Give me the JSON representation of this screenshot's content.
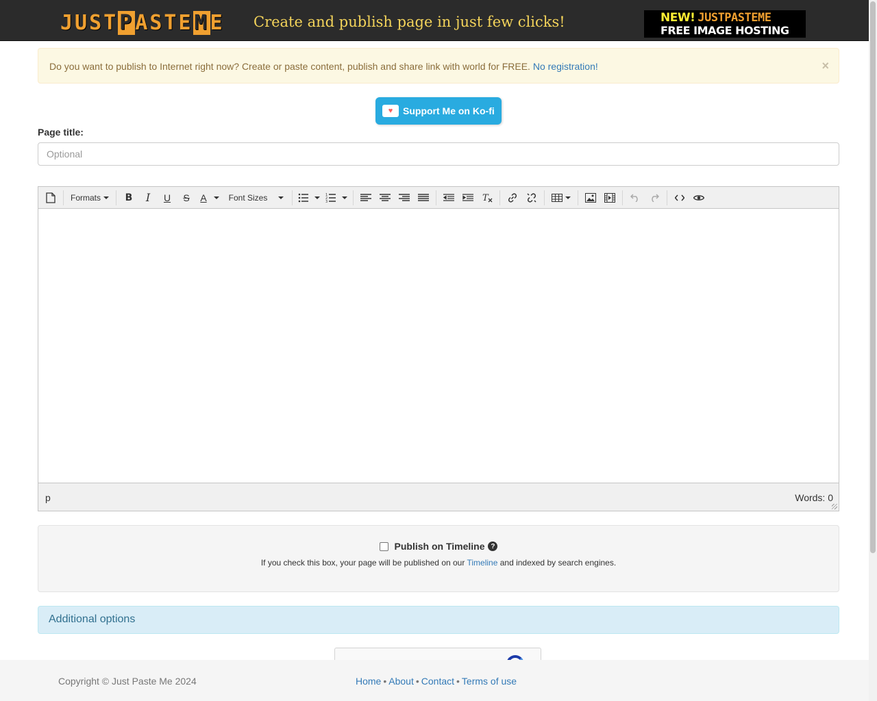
{
  "header": {
    "logo_parts": [
      "JUST",
      "P",
      "ASTE",
      "M",
      "E"
    ],
    "tagline": "Create and publish page in just few clicks!",
    "promo_new": "NEW!",
    "promo_brand": "JUSTPASTEME",
    "promo_line2": "FREE IMAGE HOSTING"
  },
  "alert": {
    "text": "Do you want to publish to Internet right now? Create or paste content, publish and share link with world for FREE.",
    "link": "No registration!",
    "close": "×"
  },
  "kofi": {
    "label": "Support Me on Ko-fi"
  },
  "form": {
    "page_title_label": "Page title:",
    "page_title_placeholder": "Optional",
    "page_title_value": ""
  },
  "editor": {
    "toolbar": {
      "formats": "Formats",
      "font_sizes": "Font Sizes",
      "bold": "B",
      "italic": "I",
      "underline": "U",
      "strike": "S",
      "text_color": "A"
    },
    "status_path": "p",
    "word_count": "Words: 0"
  },
  "publish": {
    "label": "Publish on Timeline",
    "help_icon": "?",
    "hint_before": "If you check this box, your page will be published on our",
    "hint_link": "Timeline",
    "hint_after": "and indexed by search engines."
  },
  "additional_options": "Additional options",
  "footer": {
    "copyright": "Copyright © Just Paste Me 2024",
    "links": [
      "Home",
      "About",
      "Contact",
      "Terms of use"
    ],
    "separator": "•"
  }
}
